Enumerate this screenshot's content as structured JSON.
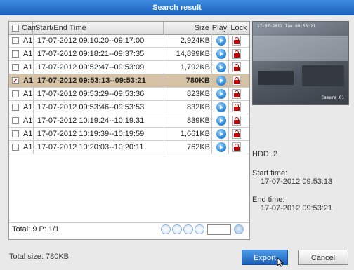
{
  "window": {
    "title": "Search result"
  },
  "table": {
    "headers": {
      "cam": "Cam",
      "time": "Start/End Time",
      "size": "Size",
      "play": "Play",
      "lock": "Lock"
    },
    "rows": [
      {
        "cam": "A1",
        "time": "17-07-2012 09:10:20--09:17:00",
        "size": "2,924KB",
        "checked": false
      },
      {
        "cam": "A1",
        "time": "17-07-2012 09:18:21--09:37:35",
        "size": "14,899KB",
        "checked": false
      },
      {
        "cam": "A1",
        "time": "17-07-2012 09:52:47--09:53:09",
        "size": "1,792KB",
        "checked": false
      },
      {
        "cam": "A1",
        "time": "17-07-2012 09:53:13--09:53:21",
        "size": "780KB",
        "checked": true
      },
      {
        "cam": "A1",
        "time": "17-07-2012 09:53:29--09:53:36",
        "size": "823KB",
        "checked": false
      },
      {
        "cam": "A1",
        "time": "17-07-2012 09:53:46--09:53:53",
        "size": "832KB",
        "checked": false
      },
      {
        "cam": "A1",
        "time": "17-07-2012 10:19:24--10:19:31",
        "size": "839KB",
        "checked": false
      },
      {
        "cam": "A1",
        "time": "17-07-2012 10:19:39--10:19:59",
        "size": "1,661KB",
        "checked": false
      },
      {
        "cam": "A1",
        "time": "17-07-2012 10:20:03--10:20:11",
        "size": "762KB",
        "checked": false
      }
    ]
  },
  "footer": {
    "total": "Total: 9  P: 1/1",
    "total_size": "Total size: 780KB"
  },
  "preview": {
    "timestamp": "17-07-2012 Tue 09:53:21",
    "camera": "Camera 01"
  },
  "details": {
    "hdd": "HDD: 2",
    "start_label": "Start time:",
    "start_value": "17-07-2012 09:53:13",
    "end_label": "End time:",
    "end_value": "17-07-2012 09:53:21"
  },
  "buttons": {
    "export": "Export",
    "cancel": "Cancel"
  },
  "icons": [
    "checkbox-icon",
    "play-icon",
    "lock-icon",
    "page-dot-icon",
    "go-icon",
    "mouse-cursor-icon"
  ],
  "colors": {
    "title_bar": "#1a5fb8",
    "selected_row": "#d6c3a5",
    "play": "#1e7fd6",
    "lock": "#c40000"
  }
}
